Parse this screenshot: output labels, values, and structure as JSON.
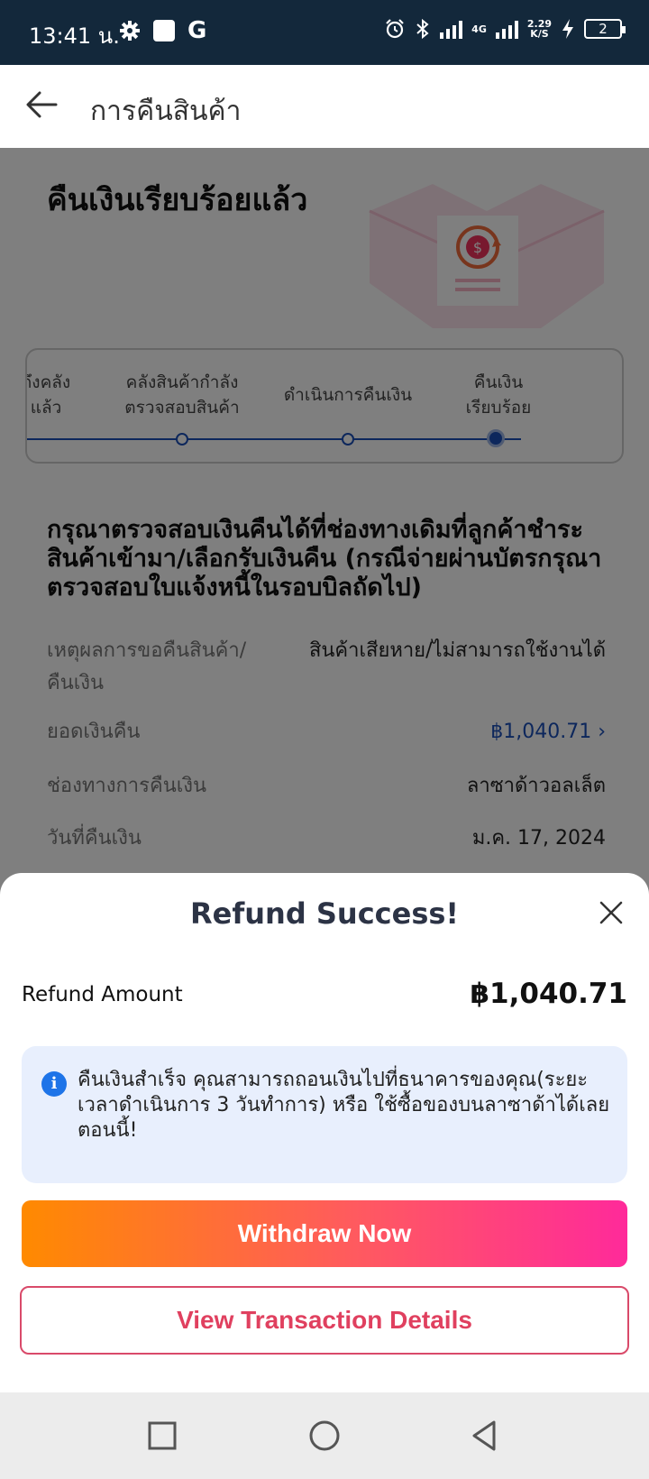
{
  "status_bar": {
    "time": "13:41 น.",
    "g_label": "G",
    "network_top": "4G",
    "speed": "2.29",
    "speed_unit": "K/S",
    "battery": "2"
  },
  "app_bar": {
    "title": "การคืนสินค้า"
  },
  "refund_status": {
    "title": "คืนเงินเรียบร้อยแล้ว"
  },
  "stepper": {
    "steps": [
      {
        "label": "ถึงคลัง\nแล้ว"
      },
      {
        "label": "คลังสินค้ากำลัง\nตรวจสอบสินค้า"
      },
      {
        "label": "ดำเนินการคืนเงิน"
      },
      {
        "label": "คืนเงิน\nเรียบร้อย"
      }
    ]
  },
  "notice": "กรุณาตรวจสอบเงินคืนได้ที่ช่องทางเดิมที่ลูกค้าชำระสินค้าเข้ามา/เลือกรับเงินคืน (กรณีจ่ายผ่านบัตรกรุณาตรวจสอบใบแจ้งหนี้ในรอบบิลถัดไป)",
  "details": [
    {
      "key": "เหตุผลการขอคืนสินค้า/คืนเงิน",
      "value": "สินค้าเสียหาย/ไม่สามารถใช้งานได้"
    },
    {
      "key": "ยอดเงินคืน",
      "value": "฿1,040.71 ›"
    },
    {
      "key": "ช่องทางการคืนเงิน",
      "value": "ลาซาด้าวอลเล็ต"
    },
    {
      "key": "วันที่คืนเงิน",
      "value": "ม.ค. 17, 2024"
    }
  ],
  "sheet": {
    "title": "Refund Success!",
    "amount_label": "Refund Amount",
    "amount_value": "฿1,040.71",
    "info_icon": "i",
    "info_text": "คืนเงินสำเร็จ คุณสามารถถอนเงินไปที่ธนาคารของคุณ(ระยะเวลาดำเนินการ 3 วันทำการ) หรือ ใช้ซื้อของบนลาซาด้าได้เลย ตอนนี้!",
    "withdraw_label": "Withdraw Now",
    "view_details_label": "View Transaction Details"
  },
  "colors": {
    "status_bar": "#13283b",
    "accent_blue": "#1b4fb8",
    "button_gradient_start": "#ff8a00",
    "button_gradient_end": "#ff2a9a",
    "secondary_button": "#e0405f",
    "info_bg": "#e8effd"
  },
  "icons": [
    "settings-icon",
    "alarm-icon",
    "bluetooth-icon",
    "signal-icon",
    "charging-icon",
    "back-arrow-icon",
    "refund-receipt-illustration",
    "close-icon",
    "info-icon",
    "recents-icon",
    "home-icon",
    "back-icon"
  ]
}
